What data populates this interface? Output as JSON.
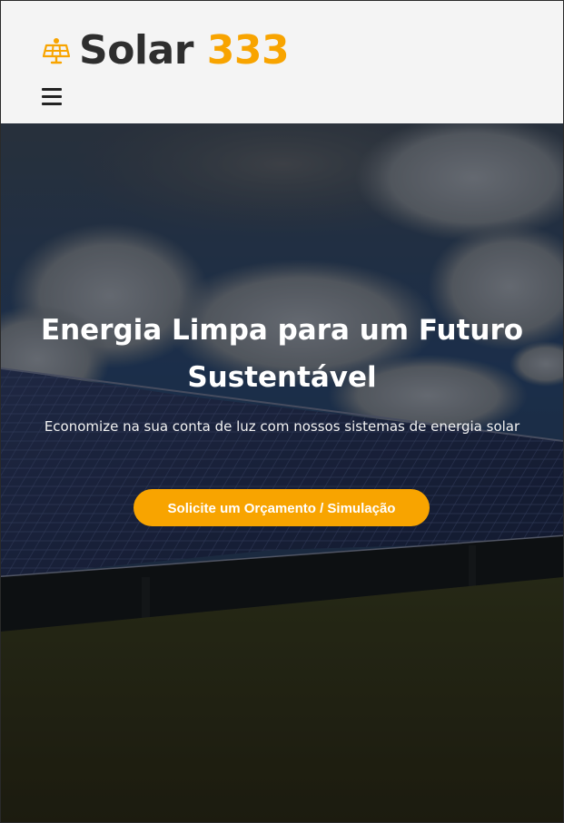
{
  "brand": {
    "name_word": "Solar",
    "name_number": "333",
    "accent_color": "#f8a400",
    "icon": "solar-panel-icon"
  },
  "nav": {
    "menu_icon": "hamburger-menu-icon"
  },
  "hero": {
    "title": "Energia Limpa para um Futuro Sustentável",
    "subtitle": "Economize na sua conta de luz com nossos sistemas de energia solar",
    "cta_label": "Solicite um Orçamento / Simulação",
    "background": "solar-panels-field-photo"
  }
}
